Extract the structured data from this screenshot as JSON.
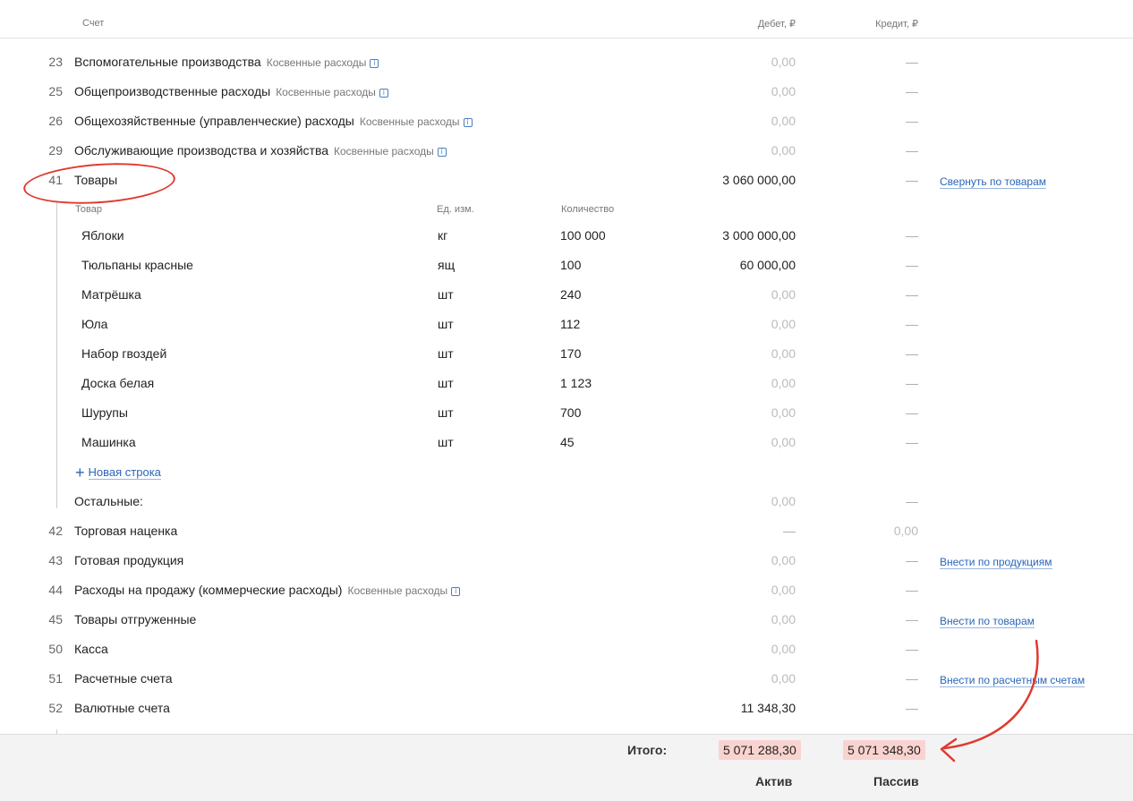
{
  "header": {
    "account": "Счет",
    "debit": "Дебет, ₽",
    "credit": "Кредит, ₽"
  },
  "indirect_label": "Косвенные расходы",
  "info_glyph": "i",
  "dash": "—",
  "accounts_top": [
    {
      "num": "23",
      "name": "Вспомогательные производства",
      "indirect": true,
      "debit": "0,00",
      "credit": "—"
    },
    {
      "num": "25",
      "name": "Общепроизводственные расходы",
      "indirect": true,
      "debit": "0,00",
      "credit": "—"
    },
    {
      "num": "26",
      "name": "Общехозяйственные (управленческие) расходы",
      "indirect": true,
      "debit": "0,00",
      "credit": "—"
    },
    {
      "num": "29",
      "name": "Обслуживающие производства и хозяйства",
      "indirect": true,
      "debit": "0,00",
      "credit": "—"
    },
    {
      "num": "41",
      "name": "Товары",
      "indirect": false,
      "debit": "3 060 000,00",
      "credit": "—",
      "link": "Свернуть по товарам"
    }
  ],
  "goods": {
    "headers": {
      "product": "Товар",
      "unit": "Ед. изм.",
      "qty": "Количество"
    },
    "rows": [
      {
        "name": "Яблоки",
        "unit": "кг",
        "qty": "100 000",
        "debit": "3 000 000,00",
        "credit": "—"
      },
      {
        "name": "Тюльпаны красные",
        "unit": "ящ",
        "qty": "100",
        "debit": "60 000,00",
        "credit": "—"
      },
      {
        "name": "Матрёшка",
        "unit": "шт",
        "qty": "240",
        "debit": "0,00",
        "credit": "—"
      },
      {
        "name": "Юла",
        "unit": "шт",
        "qty": "112",
        "debit": "0,00",
        "credit": "—"
      },
      {
        "name": "Набор гвоздей",
        "unit": "шт",
        "qty": "170",
        "debit": "0,00",
        "credit": "—"
      },
      {
        "name": "Доска белая",
        "unit": "шт",
        "qty": "1 123",
        "debit": "0,00",
        "credit": "—"
      },
      {
        "name": "Шурупы",
        "unit": "шт",
        "qty": "700",
        "debit": "0,00",
        "credit": "—"
      },
      {
        "name": "Машинка",
        "unit": "шт",
        "qty": "45",
        "debit": "0,00",
        "credit": "—"
      }
    ],
    "new_row": "Новая строка",
    "rest": {
      "name": "Остальные:",
      "debit": "0,00",
      "credit": "—"
    }
  },
  "accounts_bottom": [
    {
      "num": "42",
      "name": "Торговая наценка",
      "indirect": false,
      "debit": "—",
      "credit": "0,00"
    },
    {
      "num": "43",
      "name": "Готовая продукция",
      "indirect": false,
      "debit": "0,00",
      "credit": "—",
      "link": "Внести по продукциям"
    },
    {
      "num": "44",
      "name": "Расходы на продажу (коммерческие расходы)",
      "indirect": true,
      "debit": "0,00",
      "credit": "—"
    },
    {
      "num": "45",
      "name": "Товары отгруженные",
      "indirect": false,
      "debit": "0,00",
      "credit": "—",
      "link": "Внести по товарам"
    },
    {
      "num": "50",
      "name": "Касса",
      "indirect": false,
      "debit": "0,00",
      "credit": "—"
    },
    {
      "num": "51",
      "name": "Расчетные счета",
      "indirect": false,
      "debit": "0,00",
      "credit": "—",
      "link": "Внести по расчетным счетам"
    },
    {
      "num": "52",
      "name": "Валютные счета",
      "indirect": false,
      "debit": "11 348,30",
      "credit": "—"
    }
  ],
  "footer": {
    "total_label": "Итого:",
    "total_debit": "5 071 288,30",
    "total_credit": "5 071 348,30",
    "asset_label": "Актив",
    "liability_label": "Пассив"
  },
  "colors": {
    "annotation": "#e03a2f",
    "link": "#2a66b8",
    "badge": "#f9d3d0"
  }
}
